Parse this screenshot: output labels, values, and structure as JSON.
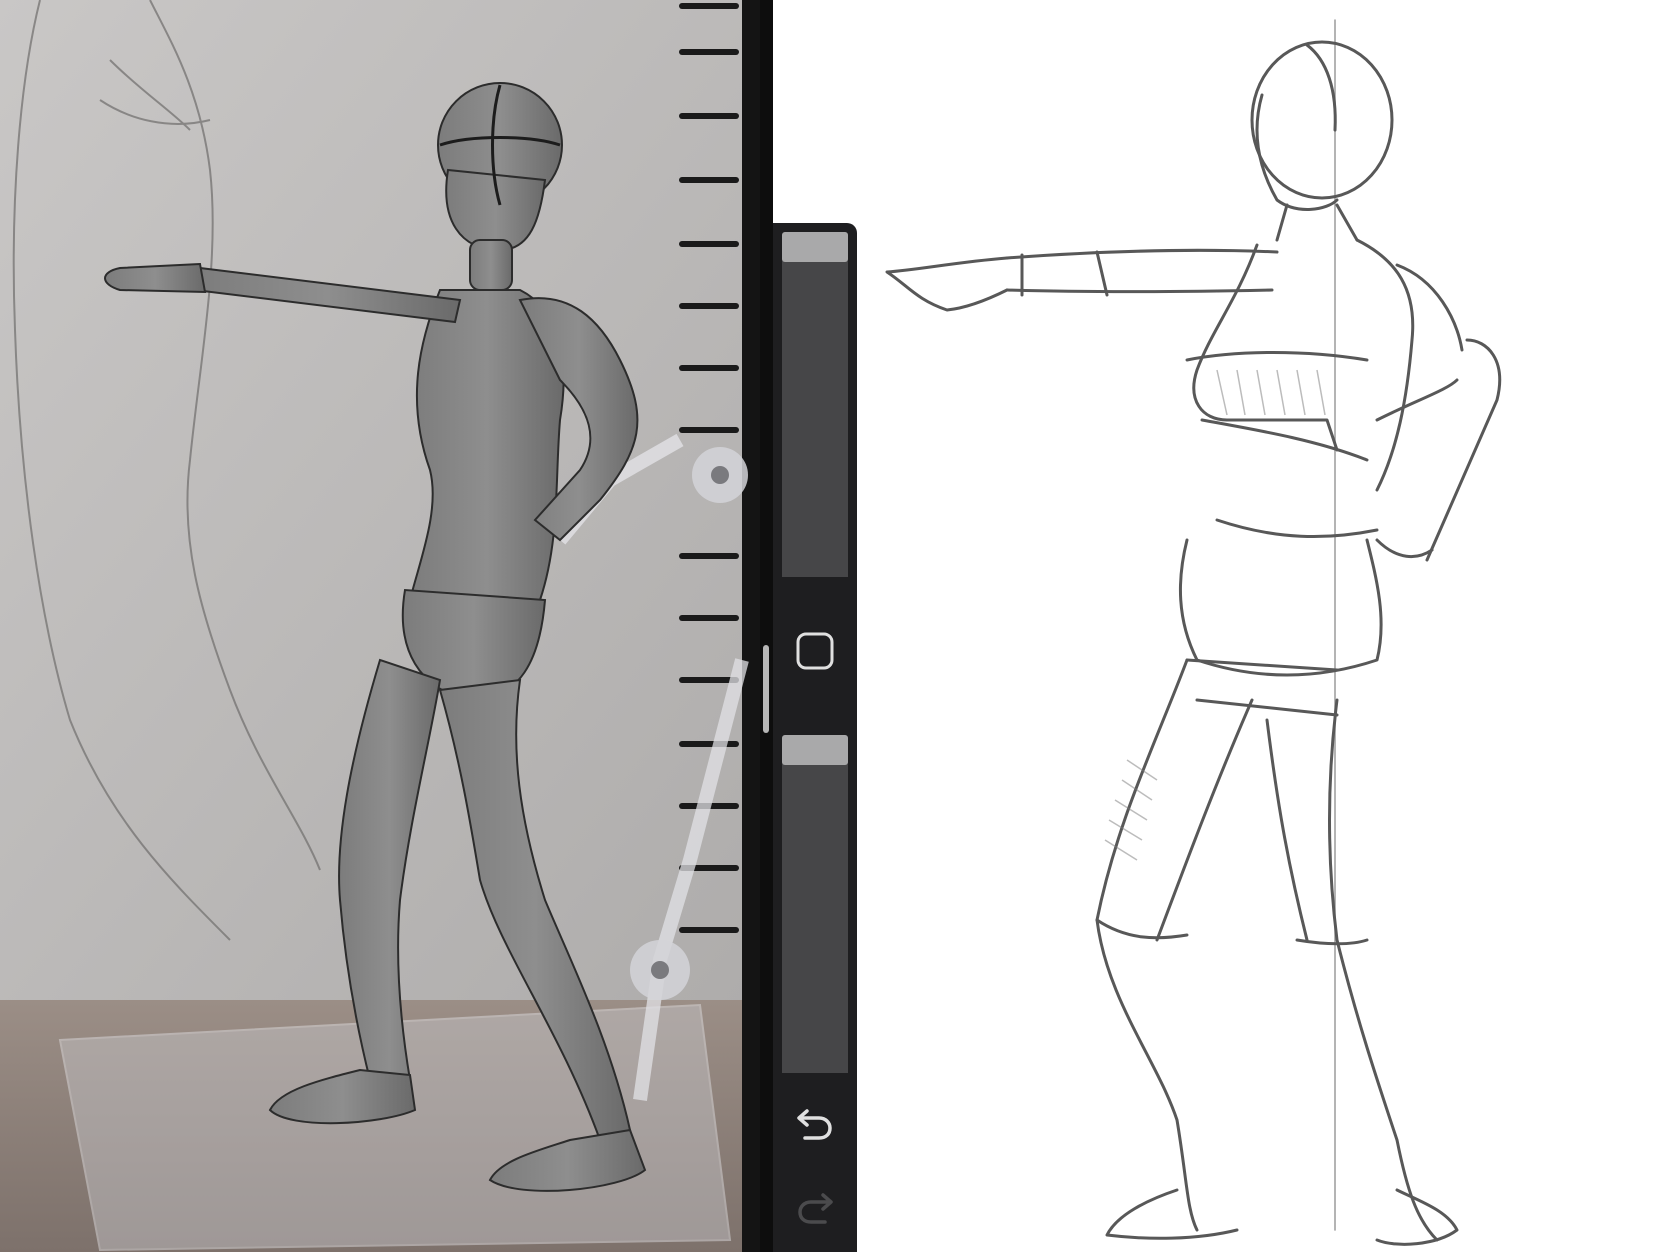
{
  "reference": {
    "title": "",
    "desc": "photo"
  },
  "toolbar": {
    "brush_size": {
      "value": 0.06
    },
    "modify_button": {
      "icon": "square-icon"
    },
    "brush_opacity": {
      "value": 0.06
    },
    "undo_button": {
      "icon": "undo-icon",
      "enabled": true
    },
    "redo_button": {
      "icon": "redo-icon",
      "enabled": false
    }
  },
  "canvas": {
    "desc": "drawing"
  },
  "colors": {
    "toolbar_bg": "#1e1e20",
    "thumb": "#a9a9aa",
    "canvas_bg": "#ffffff",
    "icon": "#e0e0e0",
    "icon_disabled": "#4b4b4d"
  }
}
